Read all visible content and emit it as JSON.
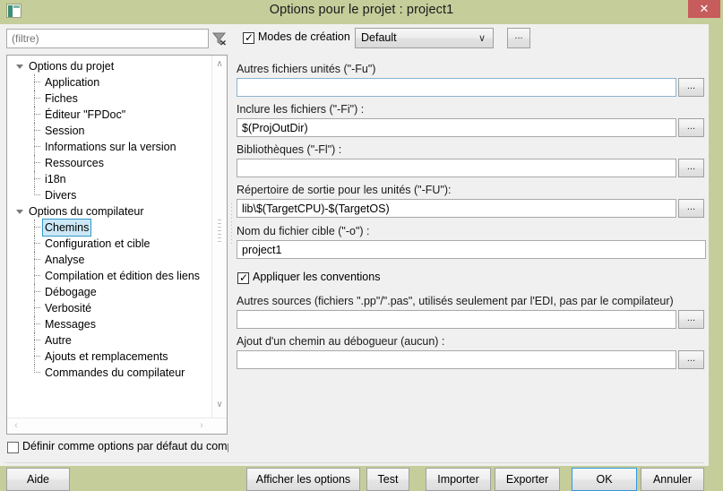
{
  "window": {
    "title": "Options pour le projet : project1",
    "icon": "project-options-icon",
    "close_label": "✕"
  },
  "toolbar": {
    "filter_value": "",
    "filter_placeholder": "(filtre)",
    "filter_icon": "filter-clear-icon",
    "modes_checkbox_label": "Modes de création",
    "modes_checkbox_checked": true,
    "modes_combo_value": "Default",
    "modes_combo_chevron": "∨",
    "modes_dots_label": "..."
  },
  "tree": {
    "items": [
      {
        "label": "Options du projet",
        "level": 0,
        "expanded": true,
        "selected": false
      },
      {
        "label": "Application",
        "level": 1,
        "expanded": false,
        "selected": false
      },
      {
        "label": "Fiches",
        "level": 1,
        "expanded": false,
        "selected": false
      },
      {
        "label": "Éditeur \"FPDoc\"",
        "level": 1,
        "expanded": false,
        "selected": false
      },
      {
        "label": "Session",
        "level": 1,
        "expanded": false,
        "selected": false
      },
      {
        "label": "Informations sur la version",
        "level": 1,
        "expanded": false,
        "selected": false
      },
      {
        "label": "Ressources",
        "level": 1,
        "expanded": false,
        "selected": false
      },
      {
        "label": "i18n",
        "level": 1,
        "expanded": false,
        "selected": false
      },
      {
        "label": "Divers",
        "level": 1,
        "expanded": false,
        "selected": false
      },
      {
        "label": "Options du compilateur",
        "level": 0,
        "expanded": true,
        "selected": false
      },
      {
        "label": "Chemins",
        "level": 1,
        "expanded": false,
        "selected": true
      },
      {
        "label": "Configuration et cible",
        "level": 1,
        "expanded": false,
        "selected": false
      },
      {
        "label": "Analyse",
        "level": 1,
        "expanded": false,
        "selected": false
      },
      {
        "label": "Compilation et édition des liens",
        "level": 1,
        "expanded": false,
        "selected": false
      },
      {
        "label": "Débogage",
        "level": 1,
        "expanded": false,
        "selected": false
      },
      {
        "label": "Verbosité",
        "level": 1,
        "expanded": false,
        "selected": false
      },
      {
        "label": "Messages",
        "level": 1,
        "expanded": false,
        "selected": false
      },
      {
        "label": "Autre",
        "level": 1,
        "expanded": false,
        "selected": false
      },
      {
        "label": "Ajouts et remplacements",
        "level": 1,
        "expanded": false,
        "selected": false
      },
      {
        "label": "Commandes du compilateur",
        "level": 1,
        "expanded": false,
        "selected": false
      }
    ],
    "scroll_up_arrow": "∧",
    "scroll_down_arrow": "∨",
    "scroll_left_arrow": "‹",
    "scroll_right_arrow": "›"
  },
  "default_options": {
    "label": "Définir comme options par défaut du comp",
    "checked": false
  },
  "fields": [
    {
      "label": "Autres fichiers unités (\"-Fu\")",
      "value": "",
      "has_dots": true,
      "dots_label": "...",
      "focused": true
    },
    {
      "label": "Inclure les fichiers (\"-Fi\") :",
      "value": "$(ProjOutDir)",
      "has_dots": true,
      "dots_label": "..."
    },
    {
      "label": "Bibliothèques (\"-Fl\") :",
      "value": "",
      "has_dots": true,
      "dots_label": "..."
    },
    {
      "label": "Répertoire de sortie pour les unités (\"-FU\"):",
      "value": "lib\\$(TargetCPU)-$(TargetOS)",
      "has_dots": true,
      "dots_label": "..."
    },
    {
      "label": "Nom du fichier cible (\"-o\") :",
      "value": "project1",
      "has_dots": false
    },
    {
      "label": "Autres sources (fichiers \".pp\"/\".pas\", utilisés seulement par l'EDI, pas par le compilateur)",
      "value": "",
      "has_dots": true,
      "dots_label": "..."
    },
    {
      "label": "Ajout d'un chemin au débogueur (aucun) :",
      "value": "",
      "has_dots": true,
      "dots_label": "..."
    }
  ],
  "apply_conventions": {
    "label": "Appliquer les conventions",
    "checked": true
  },
  "buttons": {
    "help": "Aide",
    "show_options": "Afficher les options",
    "test": "Test",
    "import": "Importer",
    "export": "Exporter",
    "ok": "OK",
    "cancel": "Annuler"
  },
  "colors": {
    "window_frame": "#c5cd9b",
    "dialog_bg": "#f0f0f0",
    "close_button": "#c75c5c",
    "selection": "#cce8f7",
    "selection_border": "#3399cc",
    "focus_border": "#3399dd"
  }
}
